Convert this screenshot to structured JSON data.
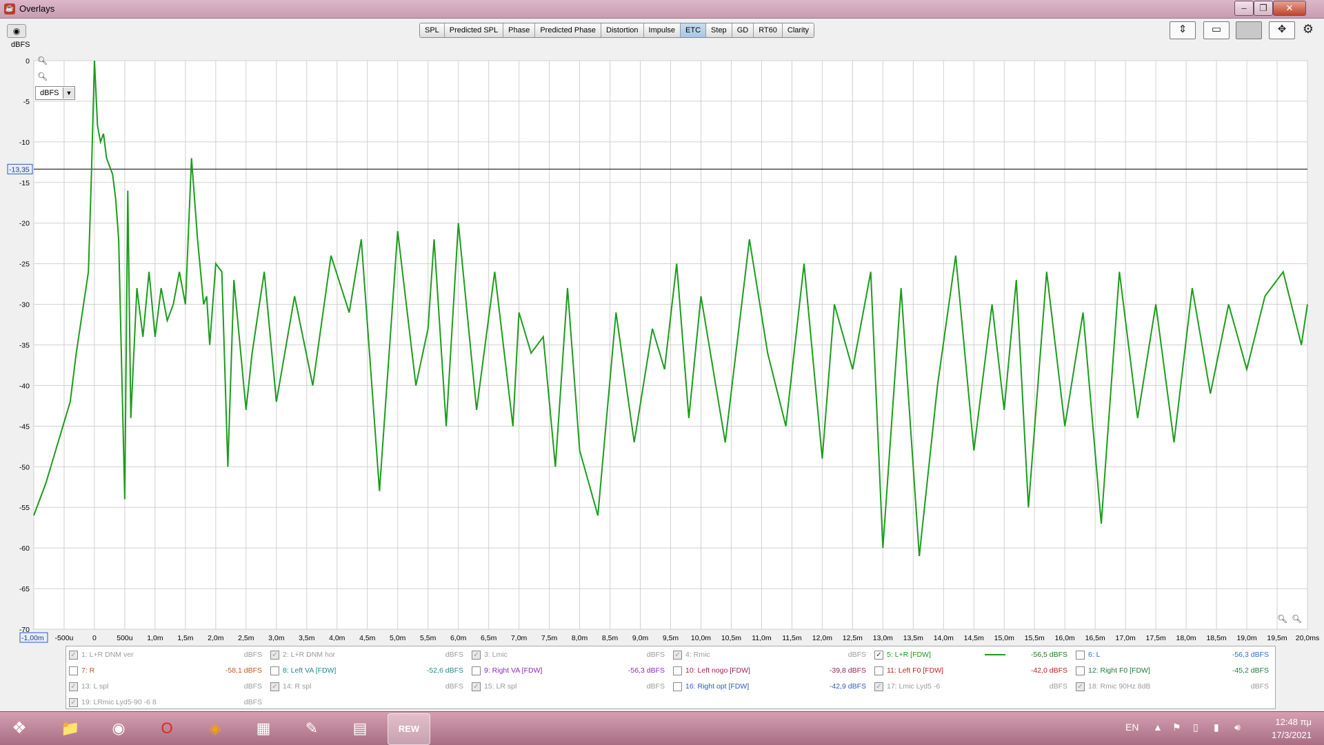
{
  "window": {
    "title": "Overlays",
    "min": "–",
    "max": "❐",
    "close": "✕"
  },
  "tabs": [
    "SPL",
    "Predicted SPL",
    "Phase",
    "Predicted Phase",
    "Distortion",
    "Impulse",
    "ETC",
    "Step",
    "GD",
    "RT60",
    "Clarity"
  ],
  "active_tab": "ETC",
  "plot": {
    "y_unit": "dBFS",
    "units_select": "dBFS",
    "y_ticks": [
      "0",
      "-5",
      "-10",
      "-15",
      "-20",
      "-25",
      "-30",
      "-35",
      "-40",
      "-45",
      "-50",
      "-55",
      "-60",
      "-65",
      "-70"
    ],
    "x_ticks": [
      "-500u",
      "0",
      "500u",
      "1,0m",
      "1,5m",
      "2,0m",
      "2,5m",
      "3,0m",
      "3,5m",
      "4,0m",
      "4,5m",
      "5,0m",
      "5,5m",
      "6,0m",
      "6,5m",
      "7,0m",
      "7,5m",
      "8,0m",
      "8,5m",
      "9,0m",
      "9,5m",
      "10,0m",
      "10,5m",
      "11,0m",
      "11,5m",
      "12,0m",
      "12,5m",
      "13,0m",
      "13,5m",
      "14,0m",
      "14,5m",
      "15,0m",
      "15,5m",
      "16,0m",
      "16,5m",
      "17,0m",
      "17,5m",
      "18,0m",
      "18,5m",
      "19,0m",
      "19,5m",
      "20,0ms"
    ],
    "x_start_label": "-1,00m",
    "cursor_label": "-13,35",
    "cursor_db": -13.35,
    "trace_color": "#1a9c1a",
    "grid_color": "#d0d0d0"
  },
  "chart_data": {
    "type": "line",
    "xlabel": "",
    "ylabel": "dBFS",
    "xlim": [
      -1.0,
      20.0
    ],
    "ylim": [
      -70,
      0
    ],
    "x_unit": "ms",
    "series": [
      {
        "name": "5: L+R [FDW]",
        "x": [
          -1.0,
          -0.8,
          -0.6,
          -0.4,
          -0.3,
          -0.2,
          -0.1,
          -0.05,
          0.0,
          0.05,
          0.1,
          0.15,
          0.2,
          0.3,
          0.35,
          0.4,
          0.5,
          0.55,
          0.6,
          0.7,
          0.8,
          0.9,
          1.0,
          1.1,
          1.2,
          1.3,
          1.4,
          1.5,
          1.6,
          1.7,
          1.8,
          1.85,
          1.9,
          2.0,
          2.1,
          2.2,
          2.3,
          2.5,
          2.6,
          2.8,
          3.0,
          3.3,
          3.6,
          3.9,
          4.2,
          4.4,
          4.7,
          5.0,
          5.3,
          5.5,
          5.6,
          5.8,
          6.0,
          6.3,
          6.6,
          6.9,
          7.0,
          7.2,
          7.4,
          7.6,
          7.8,
          8.0,
          8.3,
          8.6,
          8.9,
          9.2,
          9.4,
          9.6,
          9.8,
          10.0,
          10.4,
          10.8,
          11.1,
          11.4,
          11.7,
          12.0,
          12.2,
          12.5,
          12.8,
          13.0,
          13.3,
          13.6,
          13.9,
          14.2,
          14.5,
          14.8,
          15.0,
          15.2,
          15.4,
          15.7,
          16.0,
          16.3,
          16.6,
          16.9,
          17.2,
          17.5,
          17.8,
          18.1,
          18.4,
          18.7,
          19.0,
          19.3,
          19.6,
          19.9,
          20.0
        ],
        "y": [
          -56,
          -52,
          -47,
          -42,
          -36,
          -31,
          -26,
          -14,
          0,
          -8,
          -10,
          -9,
          -12,
          -14,
          -17,
          -22,
          -54,
          -16,
          -44,
          -28,
          -34,
          -26,
          -34,
          -28,
          -32,
          -30,
          -26,
          -30,
          -12,
          -22,
          -30,
          -29,
          -35,
          -25,
          -26,
          -50,
          -27,
          -43,
          -36,
          -26,
          -42,
          -29,
          -40,
          -24,
          -31,
          -22,
          -53,
          -21,
          -40,
          -33,
          -22,
          -45,
          -20,
          -43,
          -26,
          -45,
          -31,
          -36,
          -34,
          -50,
          -28,
          -48,
          -56,
          -31,
          -47,
          -33,
          -38,
          -25,
          -44,
          -29,
          -47,
          -22,
          -36,
          -45,
          -25,
          -49,
          -30,
          -38,
          -26,
          -60,
          -28,
          -61,
          -40,
          -24,
          -48,
          -30,
          -43,
          -27,
          -55,
          -26,
          -45,
          -31,
          -57,
          -26,
          -44,
          -30,
          -47,
          -28,
          -41,
          -30,
          -38,
          -29,
          -26,
          -35,
          -30
        ]
      }
    ]
  },
  "traces": [
    {
      "name": "1: L+R DNM ver",
      "value": "dBFS",
      "checked": true,
      "enabled": false,
      "color": "#9a9a9a"
    },
    {
      "name": "2: L+R DNM hor",
      "value": "dBFS",
      "checked": true,
      "enabled": false,
      "color": "#9a9a9a"
    },
    {
      "name": "3: Lmic",
      "value": "dBFS",
      "checked": true,
      "enabled": false,
      "color": "#9a9a9a"
    },
    {
      "name": "4: Rmic",
      "value": "dBFS",
      "checked": true,
      "enabled": false,
      "color": "#9a9a9a"
    },
    {
      "name": "5: L+R [FDW]",
      "value": "-56,5 dBFS",
      "checked": true,
      "enabled": true,
      "color": "#1a9c1a"
    },
    {
      "name": "6: L",
      "value": "-56,3 dBFS",
      "checked": false,
      "enabled": true,
      "color": "#2a6fc2"
    },
    {
      "name": "7: R",
      "value": "-58,1 dBFS",
      "checked": false,
      "enabled": true,
      "color": "#c0561e"
    },
    {
      "name": "8: Left VA [FDW]",
      "value": "-52,6 dBFS",
      "checked": false,
      "enabled": true,
      "color": "#1e8a8a"
    },
    {
      "name": "9: Right VA [FDW]",
      "value": "-56,3 dBFS",
      "checked": false,
      "enabled": true,
      "color": "#8a2ac0"
    },
    {
      "name": "10: Left nogo [FDW]",
      "value": "-39,8 dBFS",
      "checked": false,
      "enabled": true,
      "color": "#a01e5a"
    },
    {
      "name": "11: Left F0 [FDW]",
      "value": "-42,0 dBFS",
      "checked": false,
      "enabled": true,
      "color": "#c01e1e"
    },
    {
      "name": "12: Right F0 [FDW]",
      "value": "-45,2 dBFS",
      "checked": false,
      "enabled": true,
      "color": "#1e7a3a"
    },
    {
      "name": "13: L spl",
      "value": "dBFS",
      "checked": true,
      "enabled": false,
      "color": "#9a9a9a"
    },
    {
      "name": "14: R spl",
      "value": "dBFS",
      "checked": true,
      "enabled": false,
      "color": "#9a9a9a"
    },
    {
      "name": "15: LR spl",
      "value": "dBFS",
      "checked": true,
      "enabled": false,
      "color": "#9a9a9a"
    },
    {
      "name": "16: Right opt [FDW]",
      "value": "-42,9 dBFS",
      "checked": false,
      "enabled": true,
      "color": "#2a5ac2"
    },
    {
      "name": "17: Lmic Lyd5 -6",
      "value": "dBFS",
      "checked": true,
      "enabled": false,
      "color": "#9a9a9a"
    },
    {
      "name": "18: Rmic 90Hz 8dB",
      "value": "dBFS",
      "checked": true,
      "enabled": false,
      "color": "#9a9a9a"
    },
    {
      "name": "19: LRmic Lyd5-90 -6 8",
      "value": "dBFS",
      "checked": true,
      "enabled": false,
      "color": "#9a9a9a"
    }
  ],
  "taskbar": {
    "apps": [
      {
        "id": "start",
        "icon": "windows-start-icon"
      },
      {
        "id": "explorer",
        "icon": "folder-icon"
      },
      {
        "id": "chrome",
        "icon": "chrome-icon"
      },
      {
        "id": "opera",
        "icon": "opera-icon"
      },
      {
        "id": "avast",
        "icon": "browser-icon"
      },
      {
        "id": "app-red",
        "icon": "grid-app-icon"
      },
      {
        "id": "notepad",
        "icon": "notepad-icon"
      },
      {
        "id": "winrar",
        "icon": "winrar-icon"
      },
      {
        "id": "rew",
        "icon": "rew-icon",
        "label": "REW"
      }
    ],
    "language": "EN",
    "time": "12:48 πμ",
    "date": "17/3/2021"
  }
}
